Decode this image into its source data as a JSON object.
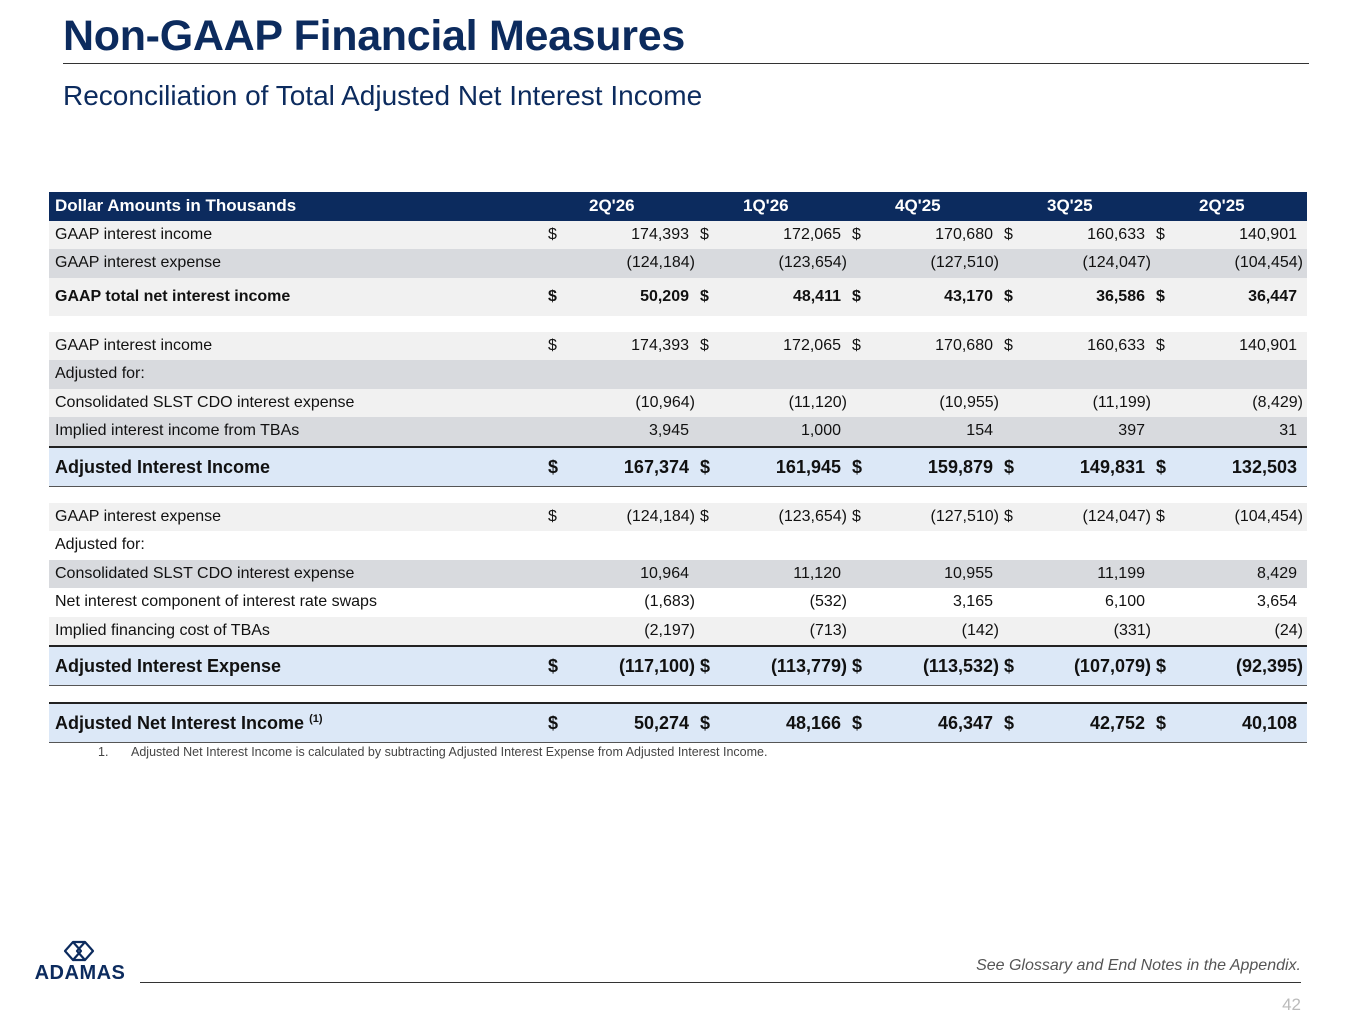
{
  "header": {
    "title": "Non-GAAP Financial Measures",
    "subtitle": "Reconciliation of Total Adjusted Net Interest Income"
  },
  "table": {
    "label_header": "Dollar Amounts in Thousands",
    "periods": [
      "2Q'26",
      "1Q'26",
      "4Q'25",
      "3Q'25",
      "2Q'25"
    ],
    "rows": [
      {
        "label": "GAAP interest income",
        "cur": true,
        "values": [
          "174,393",
          "172,065",
          "170,680",
          "160,633",
          "140,901"
        ],
        "style": "normal",
        "bg": "light"
      },
      {
        "label": "GAAP interest expense",
        "cur": false,
        "values": [
          "(124,184)",
          "(123,654)",
          "(127,510)",
          "(124,047)",
          "(104,454)"
        ],
        "style": "normal",
        "bg": "mid"
      },
      {
        "label": "GAAP total net interest income",
        "cur": true,
        "values": [
          "50,209",
          "48,411",
          "43,170",
          "36,586",
          "36,447"
        ],
        "style": "total-gaap",
        "bg": "light"
      },
      {
        "spacer": true
      },
      {
        "label": "GAAP interest income",
        "cur": true,
        "values": [
          "174,393",
          "172,065",
          "170,680",
          "160,633",
          "140,901"
        ],
        "style": "normal",
        "bg": "light"
      },
      {
        "label": "Adjusted for:",
        "cur": false,
        "values": [
          "",
          "",
          "",
          "",
          ""
        ],
        "style": "normal",
        "bg": "mid"
      },
      {
        "label": "Consolidated SLST CDO interest expense",
        "cur": false,
        "values": [
          "(10,964)",
          "(11,120)",
          "(10,955)",
          "(11,199)",
          "(8,429)"
        ],
        "style": "normal",
        "bg": "light"
      },
      {
        "label": "Implied interest income from TBAs",
        "cur": false,
        "values": [
          "3,945",
          "1,000",
          "154",
          "397",
          "31"
        ],
        "style": "normal",
        "bg": "mid"
      },
      {
        "label": "Adjusted Interest Income",
        "cur": true,
        "values": [
          "167,374",
          "161,945",
          "159,879",
          "149,831",
          "132,503"
        ],
        "style": "big",
        "bg": "adj"
      },
      {
        "spacer": true
      },
      {
        "label": "GAAP interest expense",
        "cur": true,
        "values": [
          "(124,184)",
          "(123,654)",
          "(127,510)",
          "(124,047)",
          "(104,454)"
        ],
        "style": "normal",
        "bg": "light"
      },
      {
        "label": "Adjusted for:",
        "cur": false,
        "values": [
          "",
          "",
          "",
          "",
          ""
        ],
        "style": "normal",
        "bg": "white"
      },
      {
        "label": "Consolidated SLST CDO interest expense",
        "cur": false,
        "values": [
          "10,964",
          "11,120",
          "10,955",
          "11,199",
          "8,429"
        ],
        "style": "normal",
        "bg": "mid"
      },
      {
        "label": "Net interest component of interest rate swaps",
        "cur": false,
        "values": [
          "(1,683)",
          "(532)",
          "3,165",
          "6,100",
          "3,654"
        ],
        "style": "normal",
        "bg": "white"
      },
      {
        "label": "Implied financing cost of TBAs",
        "cur": false,
        "values": [
          "(2,197)",
          "(713)",
          "(142)",
          "(331)",
          "(24)"
        ],
        "style": "normal",
        "bg": "light"
      },
      {
        "label": "Adjusted Interest Expense",
        "cur": true,
        "values": [
          "(117,100)",
          "(113,779)",
          "(113,532)",
          "(107,079)",
          "(92,395)"
        ],
        "style": "big",
        "bg": "adj"
      },
      {
        "spacer": true
      },
      {
        "label": "Adjusted Net Interest Income",
        "sup": "(1)",
        "cur": true,
        "values": [
          "50,274",
          "48,166",
          "46,347",
          "42,752",
          "40,108"
        ],
        "style": "big",
        "bg": "adj"
      }
    ],
    "currency_symbol": "$"
  },
  "footnote": {
    "number": "1.",
    "text": "Adjusted Net Interest Income is calculated by subtracting Adjusted Interest Expense from Adjusted Interest Income."
  },
  "footer": {
    "logo_text": "ADAMAS",
    "glossary_note": "See Glossary and End Notes in the Appendix.",
    "page_number": "42"
  },
  "colors": {
    "brand_navy": "#0c2b5e",
    "adjusted_row": "#dce8f7",
    "row_light": "#f1f1f1",
    "row_mid": "#d8dade"
  }
}
